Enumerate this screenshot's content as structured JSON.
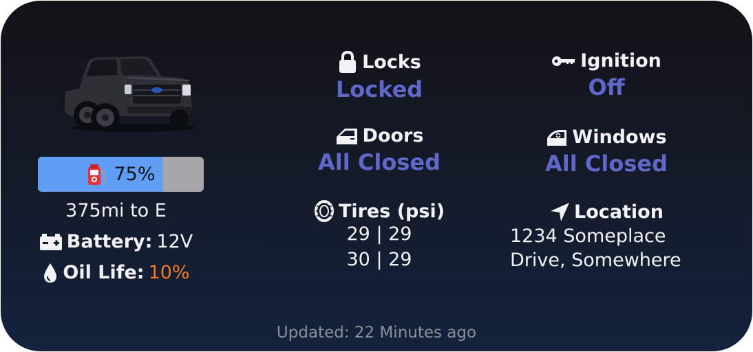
{
  "fuel": {
    "level_percent": 75,
    "label": "75%",
    "fill_color": "#5f9ef4",
    "icon": "fuel-pump-icon"
  },
  "range": "375mi to E",
  "battery": {
    "label": "Battery:",
    "value": "12V",
    "icon": "battery-icon"
  },
  "oil": {
    "label": "Oil Life:",
    "value": "10%",
    "value_color": "#ef7a24",
    "icon": "oil-drop-icon"
  },
  "locks": {
    "label": "Locks",
    "value": "Locked",
    "icon": "lock-icon"
  },
  "ignition": {
    "label": "Ignition",
    "value": "Off",
    "icon": "key-icon"
  },
  "doors": {
    "label": "Doors",
    "value": "All Closed",
    "icon": "door-icon"
  },
  "windows": {
    "label": "Windows",
    "value": "All Closed",
    "icon": "window-icon"
  },
  "tires": {
    "label": "Tires (psi)",
    "front": "29 | 29",
    "rear": "30 | 29",
    "icon": "tire-icon"
  },
  "location": {
    "label": "Location",
    "line1": "1234 Someplace",
    "line2": "Drive, Somewhere",
    "icon": "location-arrow-icon"
  },
  "footer": "Updated: 22 Minutes ago",
  "colors": {
    "status_value": "#5f67c9",
    "accent_orange": "#ef7a24",
    "background_top": "#121317",
    "background_bottom": "#14223d"
  }
}
